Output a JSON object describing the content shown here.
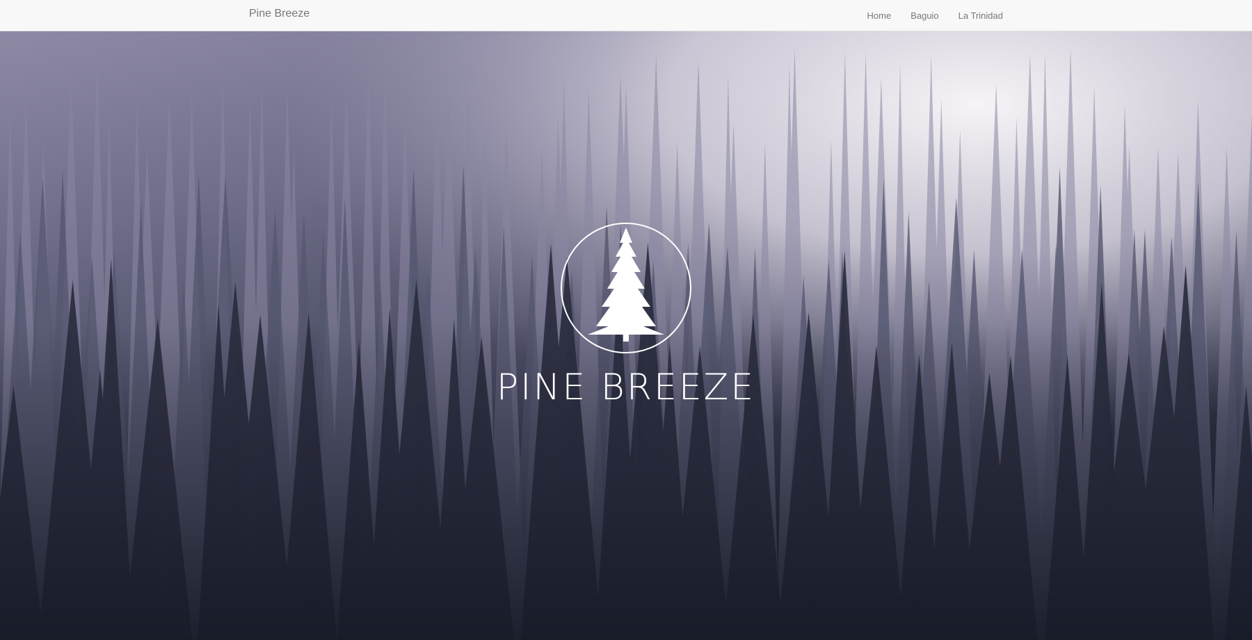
{
  "navbar": {
    "brand": "Pine Breeze",
    "links": [
      {
        "label": "Home"
      },
      {
        "label": "Baguio"
      },
      {
        "label": "La Trinidad"
      }
    ]
  },
  "hero": {
    "title": "PINE BREEZE",
    "emblem_icon": "pine-tree-icon",
    "text_color": "#ffffff"
  },
  "colors": {
    "navbar_bg": "#f8f8f8",
    "nav_text": "#777777",
    "fog_light": "#e9e6ee",
    "forest_dark": "#1b1e2c"
  }
}
